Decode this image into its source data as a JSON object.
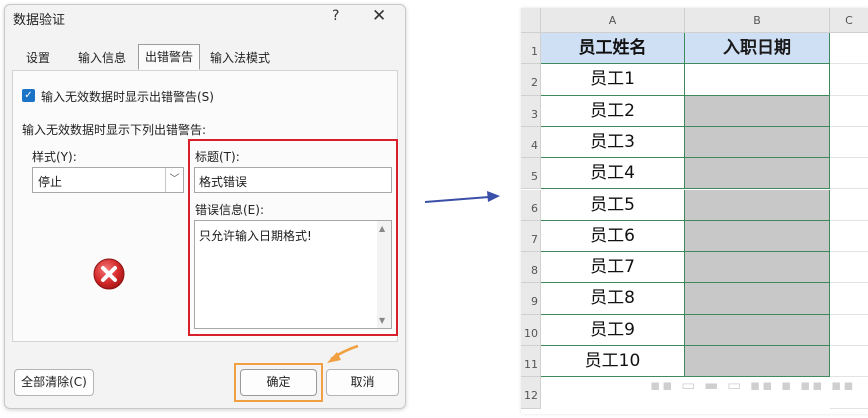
{
  "dialog": {
    "title": "数据验证",
    "help_symbol": "?",
    "close_symbol": "✕",
    "tabs": [
      {
        "label": "设置",
        "active": false
      },
      {
        "label": "输入信息",
        "active": false
      },
      {
        "label": "出错警告",
        "active": true
      },
      {
        "label": "输入法模式",
        "active": false
      }
    ],
    "show_error_checkbox": {
      "checked": true,
      "label": "输入无效数据时显示出错警告(S)"
    },
    "section_label": "输入无效数据时显示下列出错警告:",
    "style_label": "样式(Y):",
    "style_value": "停止",
    "title_label": "标题(T):",
    "title_value": "格式错误",
    "message_label": "错误信息(E):",
    "message_value": "只允许输入日期格式!",
    "clear_all_button": "全部清除(C)",
    "ok_button": "确定",
    "cancel_button": "取消",
    "error_icon": "error-stop-icon"
  },
  "sheet": {
    "columns": [
      "A",
      "B",
      "C"
    ],
    "rows": [
      "1",
      "2",
      "3",
      "4",
      "5",
      "6",
      "7",
      "8",
      "9",
      "10",
      "11",
      "12"
    ],
    "header_a": "员工姓名",
    "header_b": "入职日期",
    "employees": [
      "员工1",
      "员工2",
      "员工3",
      "员工4",
      "员工5",
      "员工6",
      "员工7",
      "员工8",
      "员工9",
      "员工10"
    ],
    "header_fill_color": "#cfe0f5",
    "shaded_cell_color": "#c8c8c8",
    "border_color": "#3e8a5c"
  },
  "colors": {
    "highlight_red": "#d8202a",
    "highlight_orange": "#f0a040",
    "arrow_blue": "#3a4fa8",
    "checkbox_blue": "#1a73c7"
  }
}
